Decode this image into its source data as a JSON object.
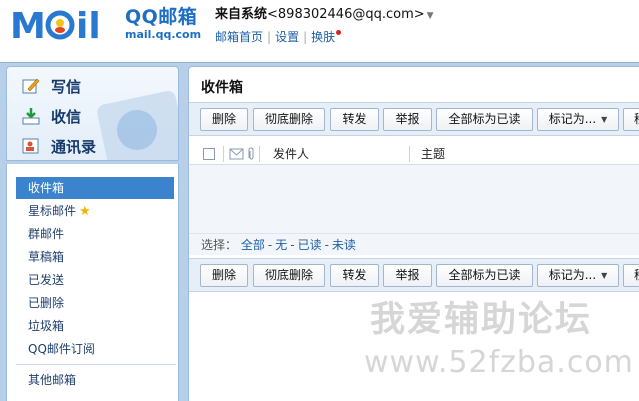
{
  "brand": {
    "logo_text": "MOil",
    "name": "QQ邮箱",
    "url": "mail.qq.com"
  },
  "user": {
    "name": "来自系统",
    "email": "<898302446@qq.com>",
    "caret": "▼",
    "links": [
      "邮箱首页",
      "设置",
      "换肤"
    ]
  },
  "sidebar": {
    "actions": [
      {
        "label": "写信",
        "icon": "compose-icon"
      },
      {
        "label": "收信",
        "icon": "inbox-download-icon"
      },
      {
        "label": "通讯录",
        "icon": "contacts-icon"
      }
    ],
    "folders": [
      {
        "label": "收件箱",
        "active": true
      },
      {
        "label": "星标邮件",
        "star": "★"
      },
      {
        "label": "群邮件"
      },
      {
        "label": "草稿箱"
      },
      {
        "label": "已发送"
      },
      {
        "label": "已删除"
      },
      {
        "label": "垃圾箱"
      },
      {
        "label": "QQ邮件订阅"
      },
      {
        "label": "其他邮箱"
      }
    ]
  },
  "main": {
    "title": "收件箱",
    "toolbar": {
      "delete": "删除",
      "purge": "彻底删除",
      "forward": "转发",
      "report": "举报",
      "mark_all_read": "全部标为已读",
      "mark_as": "标记为...",
      "move": "移"
    },
    "columns": {
      "sender": "发件人",
      "subject": "主题"
    },
    "select_bar": {
      "prefix": "选择：",
      "all": "全部",
      "none": "无",
      "read": "已读",
      "unread": "未读",
      "sep": "-"
    }
  },
  "watermark": {
    "line1": "我爱辅助论坛",
    "line2": "www.52fzba.com"
  },
  "colors": {
    "accent": "#3b83cd",
    "brand_blue": "#1d6fc3",
    "frame": "#b7cfe8"
  }
}
